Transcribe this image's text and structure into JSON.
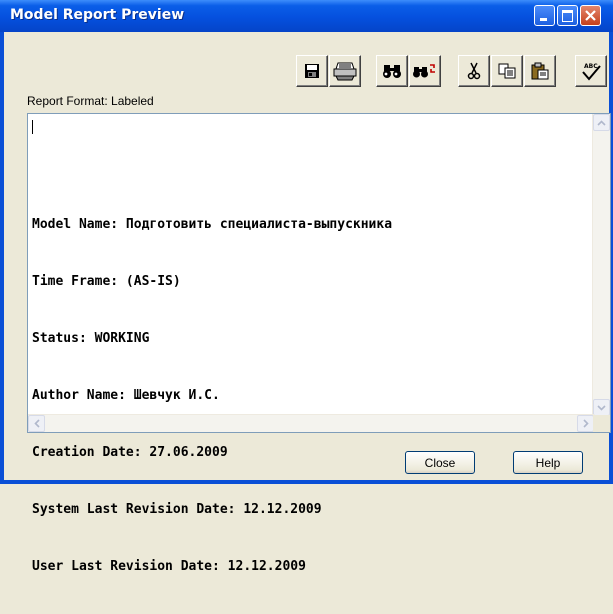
{
  "window": {
    "title": "Model Report Preview",
    "controls": [
      "minimize-icon",
      "maximize-icon",
      "close-icon"
    ]
  },
  "toolbar": {
    "groups": [
      [
        "save-icon",
        "print-icon"
      ],
      [
        "find-icon",
        "find-replace-icon"
      ],
      [
        "cut-icon",
        "copy-icon",
        "paste-icon"
      ],
      [
        "spell-check-icon"
      ]
    ]
  },
  "report": {
    "format_label": "Report Format: Labeled",
    "lines": [
      "Model Name: Подготовить специалиста-выпускника",
      "Time Frame: (AS-IS)",
      "Status: WORKING",
      "Author Name: Шевчук И.С.",
      "Creation Date: 27.06.2009",
      "System Last Revision Date: 12.12.2009",
      "User Last Revision Date: 12.12.2009"
    ]
  },
  "buttons": {
    "close": "Close",
    "help": "Help"
  },
  "icons": {
    "spell_check_text": "ABC"
  }
}
